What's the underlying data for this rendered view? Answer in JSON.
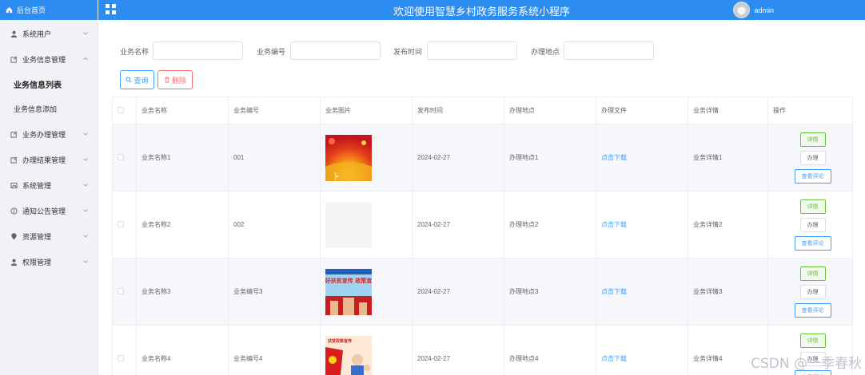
{
  "brand": {
    "label": "后台首页"
  },
  "header": {
    "title": "欢迎使用智慧乡村政务服务系统小程序",
    "user": "admin"
  },
  "sidebar": {
    "items": [
      {
        "label": "系统用户"
      },
      {
        "label": "业务信息管理"
      },
      {
        "label": "业务信息列表"
      },
      {
        "label": "业务信息添加"
      },
      {
        "label": "业务办理管理"
      },
      {
        "label": "办理结果管理"
      },
      {
        "label": "系统管理"
      },
      {
        "label": "通知公告管理"
      },
      {
        "label": "资源管理"
      },
      {
        "label": "权限管理"
      }
    ]
  },
  "search": {
    "fields": [
      {
        "label": "业务名称"
      },
      {
        "label": "业务编号"
      },
      {
        "label": "发布时间"
      },
      {
        "label": "办理地点"
      }
    ],
    "query_label": "查询",
    "delete_label": "删除"
  },
  "table": {
    "headers": [
      "业务名称",
      "业务编号",
      "业务图片",
      "发布时间",
      "办理地点",
      "办理文件",
      "业务详情",
      "操作"
    ],
    "rows": [
      {
        "name": "业务名称1",
        "code": "001",
        "date": "2024-02-27",
        "place": "办理地点1",
        "file": "点击下载",
        "detail": "业务详情1"
      },
      {
        "name": "业务名称2",
        "code": "002",
        "date": "2024-02-27",
        "place": "办理地点2",
        "file": "点击下载",
        "detail": "业务详情2"
      },
      {
        "name": "业务名称3",
        "code": "业务编号3",
        "date": "2024-02-27",
        "place": "办理地点3",
        "file": "点击下载",
        "detail": "业务详情3"
      },
      {
        "name": "业务名称4",
        "code": "业务编号4",
        "date": "2024-02-27",
        "place": "办理地点4",
        "file": "点击下载",
        "detail": "业务详情4"
      }
    ],
    "image_texts": {
      "row3": "做好扶贫宣传 政策宣传",
      "row4": "扶贫政策宣传"
    },
    "ops": {
      "detail": "详情",
      "handle": "办理",
      "comment": "查看评论"
    }
  },
  "watermark": "CSDN @一季春秋",
  "colors": {
    "primary": "#2d8cf0",
    "link": "#409eff",
    "success": "#67c23a",
    "danger": "#f56c6c"
  }
}
